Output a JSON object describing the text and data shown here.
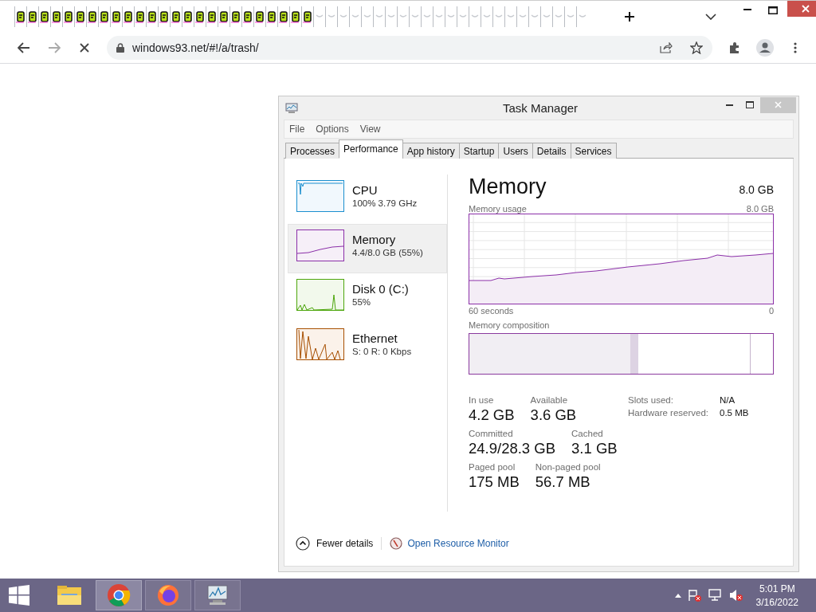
{
  "browser": {
    "tabs": [
      {
        "kind": "loaded"
      },
      {
        "kind": "loaded"
      },
      {
        "kind": "loaded"
      },
      {
        "kind": "loaded"
      },
      {
        "kind": "loaded"
      },
      {
        "kind": "loaded"
      },
      {
        "kind": "loaded"
      },
      {
        "kind": "loaded"
      },
      {
        "kind": "loaded"
      },
      {
        "kind": "loaded"
      },
      {
        "kind": "loaded"
      },
      {
        "kind": "loaded"
      },
      {
        "kind": "loaded"
      },
      {
        "kind": "loaded"
      },
      {
        "kind": "loaded"
      },
      {
        "kind": "loaded"
      },
      {
        "kind": "loaded"
      },
      {
        "kind": "loaded"
      },
      {
        "kind": "loaded"
      },
      {
        "kind": "loaded"
      },
      {
        "kind": "loaded"
      },
      {
        "kind": "loaded"
      },
      {
        "kind": "loaded"
      },
      {
        "kind": "loaded"
      },
      {
        "kind": "loaded"
      },
      {
        "kind": "blank"
      },
      {
        "kind": "blank"
      },
      {
        "kind": "blank"
      },
      {
        "kind": "blank"
      },
      {
        "kind": "blank"
      },
      {
        "kind": "blank"
      },
      {
        "kind": "blank"
      },
      {
        "kind": "blank"
      },
      {
        "kind": "blank"
      },
      {
        "kind": "blank"
      },
      {
        "kind": "blank"
      },
      {
        "kind": "blank"
      },
      {
        "kind": "blank"
      },
      {
        "kind": "blank"
      },
      {
        "kind": "blank"
      },
      {
        "kind": "blank"
      },
      {
        "kind": "blank"
      },
      {
        "kind": "blank"
      },
      {
        "kind": "blank"
      },
      {
        "kind": "blank"
      },
      {
        "kind": "blank"
      },
      {
        "kind": "blank"
      },
      {
        "kind": "blank"
      }
    ],
    "address": "windows93.net/#!/a/trash/"
  },
  "task_manager": {
    "title": "Task Manager",
    "menu": [
      "File",
      "Options",
      "View"
    ],
    "tabs": [
      {
        "label": "Processes",
        "selected": false
      },
      {
        "label": "Performance",
        "selected": true
      },
      {
        "label": "App history",
        "selected": false
      },
      {
        "label": "Startup",
        "selected": false
      },
      {
        "label": "Users",
        "selected": false
      },
      {
        "label": "Details",
        "selected": false
      },
      {
        "label": "Services",
        "selected": false
      }
    ],
    "sidebar": [
      {
        "kind": "cpu",
        "name": "CPU",
        "detail": "100%  3.79 GHz",
        "selected": false
      },
      {
        "kind": "memory",
        "name": "Memory",
        "detail": "4.4/8.0 GB (55%)",
        "selected": true
      },
      {
        "kind": "disk",
        "name": "Disk 0 (C:)",
        "detail": "55%",
        "selected": false
      },
      {
        "kind": "ethernet",
        "name": "Ethernet",
        "detail": "S: 0 R: 0 Kbps",
        "selected": false
      }
    ],
    "panel": {
      "title": "Memory",
      "total": "8.0 GB",
      "graph_label": "Memory usage",
      "graph_max": "8.0 GB",
      "graph_start": "60 seconds",
      "graph_end": "0",
      "composition_label": "Memory composition",
      "stats": [
        [
          {
            "label": "In use",
            "value": "4.2 GB"
          },
          {
            "label": "Available",
            "value": "3.6 GB"
          }
        ],
        [
          {
            "label": "Committed",
            "value": "24.9/28.3 GB"
          },
          {
            "label": "Cached",
            "value": "3.1 GB"
          }
        ],
        [
          {
            "label": "Paged pool",
            "value": "175 MB"
          },
          {
            "label": "Non-paged pool",
            "value": "56.7 MB"
          }
        ]
      ],
      "details": [
        {
          "label": "Slots used:",
          "value": "N/A"
        },
        {
          "label": "Hardware reserved:",
          "value": "0.5 MB"
        }
      ]
    },
    "footer": {
      "fewer": "Fewer details",
      "monitor": "Open Resource Monitor"
    }
  },
  "taskbar": {
    "apps": [
      {
        "kind": "explorer",
        "running": false,
        "selected": false
      },
      {
        "kind": "chrome",
        "running": true,
        "selected": true
      },
      {
        "kind": "firefox",
        "running": true,
        "selected": false
      },
      {
        "kind": "taskmgr",
        "running": true,
        "selected": false
      }
    ],
    "time": "5:01 PM",
    "date": "3/16/2022"
  }
}
